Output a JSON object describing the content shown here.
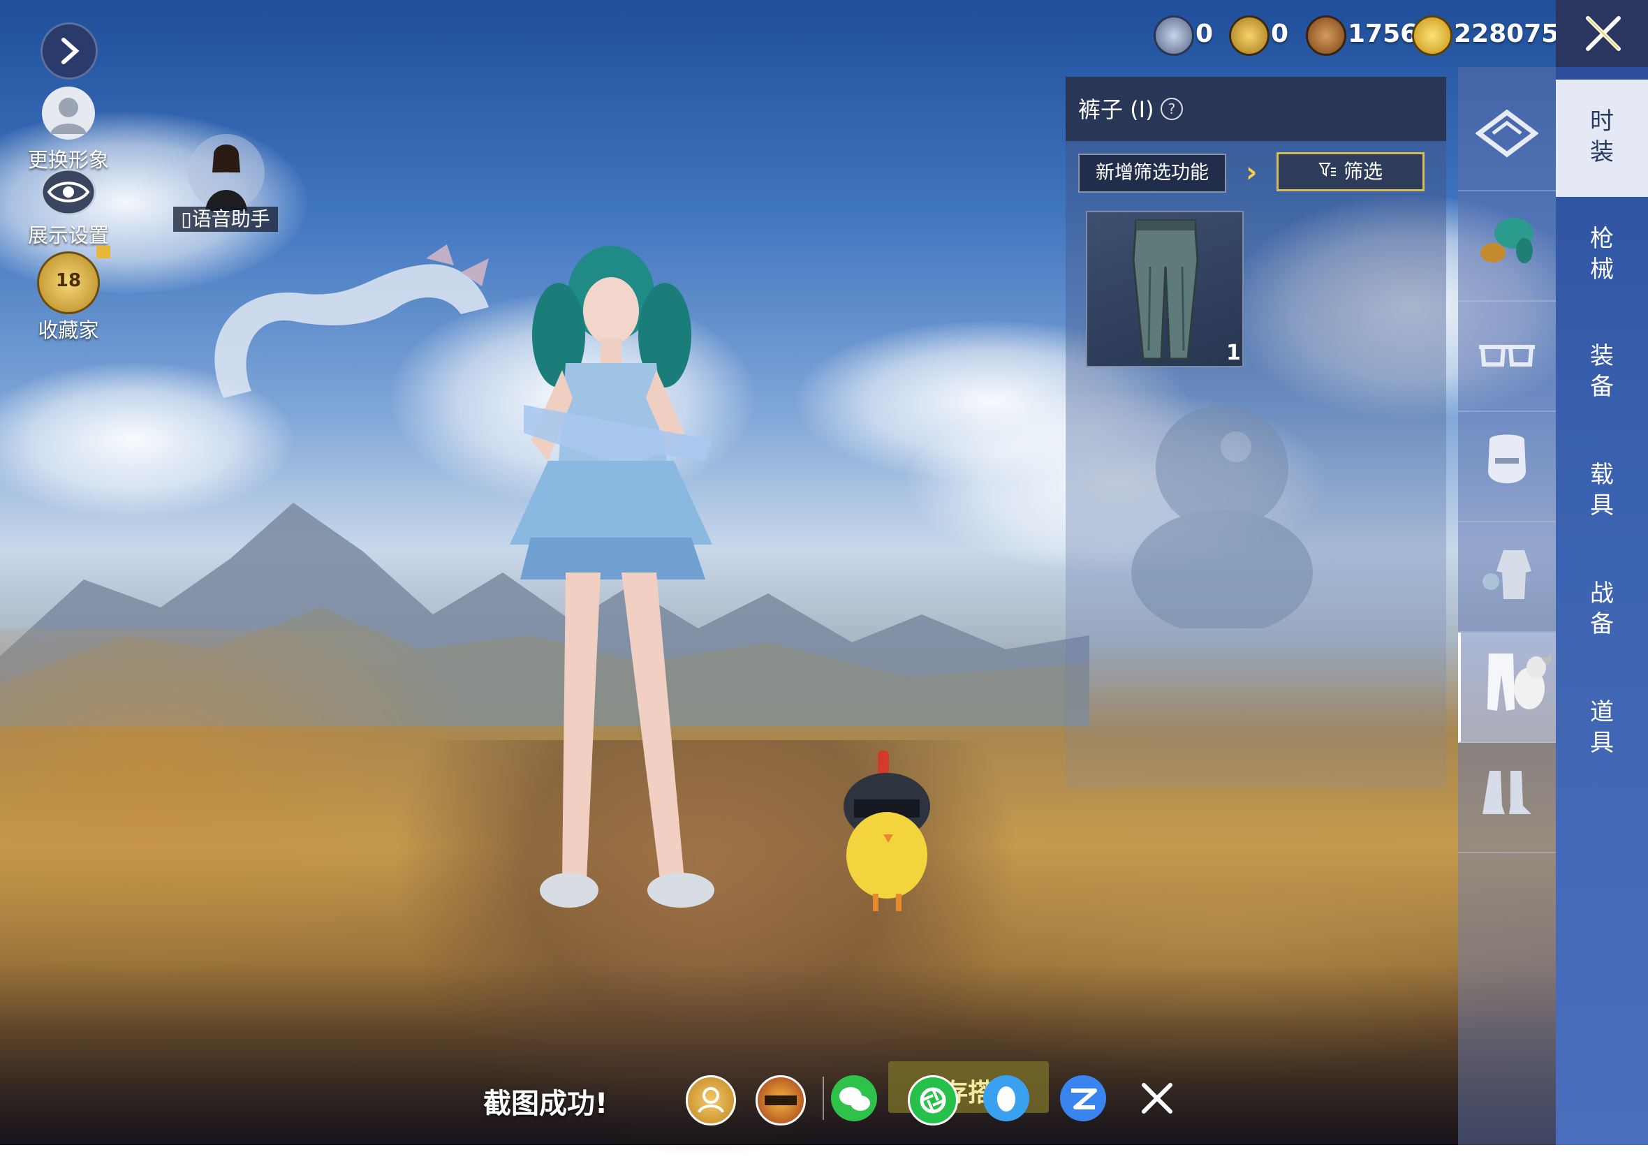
{
  "currencies": [
    {
      "icon": "silver-badge-icon",
      "value": "0",
      "color": "#7d8fb4"
    },
    {
      "icon": "gold-badge-icon",
      "value": "0",
      "color": "#d8a426"
    },
    {
      "icon": "bronze-coin-icon",
      "value": "1756",
      "color": "#a4682f"
    },
    {
      "icon": "lightning-coin-icon",
      "value": "228075",
      "color": "#e8c02e"
    }
  ],
  "left_menu": {
    "change_look": "更换形象",
    "display_settings": "展示设置",
    "collector": "收藏家",
    "collector_level": "18",
    "voice_assistant": "语音助手"
  },
  "panel": {
    "title": "裤子 (I)",
    "help": "?",
    "filter_add": "新增筛选功能",
    "filter_button": "筛选",
    "item_count": "1"
  },
  "categories": [
    {
      "name": "cat-top-icon"
    },
    {
      "name": "cat-hair-icon"
    },
    {
      "name": "cat-glasses-icon"
    },
    {
      "name": "cat-mask-icon"
    },
    {
      "name": "cat-suit-icon"
    },
    {
      "name": "cat-pants-icon",
      "active": true
    },
    {
      "name": "cat-shoes-icon"
    }
  ],
  "tabs": [
    {
      "top": "时",
      "bottom": "装",
      "active": true
    },
    {
      "top": "枪",
      "bottom": "械"
    },
    {
      "top": "装",
      "bottom": "备"
    },
    {
      "top": "载",
      "bottom": "具"
    },
    {
      "top": "战",
      "bottom": "备"
    },
    {
      "top": "道",
      "bottom": "具"
    }
  ],
  "bottom_bar": {
    "toast": "截图成功!",
    "save_partial": "存搭"
  },
  "colors": {
    "tab_bg": "#2c4f9d",
    "accent_gold": "#d7bd58",
    "panel_header": "#28344f"
  }
}
